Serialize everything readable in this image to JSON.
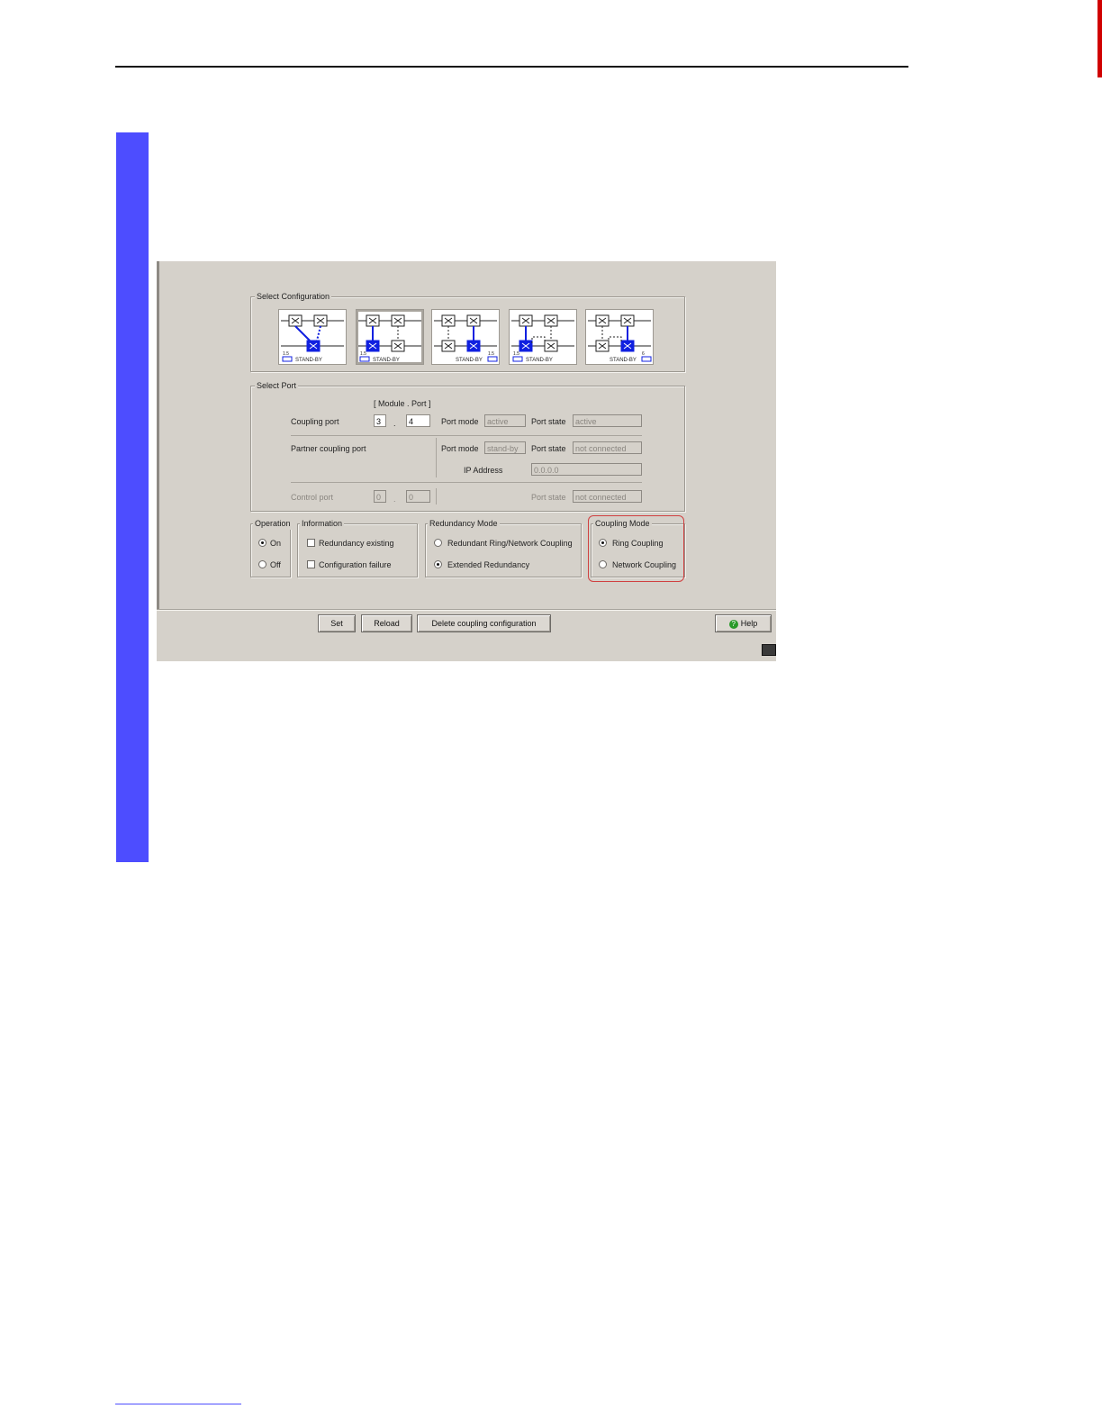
{
  "colors": {
    "sidebar": "#4d4dff",
    "tab": "#d00000",
    "highlight": "#d04040",
    "active_switch": "#1020e0"
  },
  "select_configuration": {
    "title": "Select Configuration",
    "options": [
      {
        "badge": "1.5",
        "caption": "STAND-BY",
        "selected": false
      },
      {
        "badge": "1.5",
        "caption": "STAND-BY",
        "selected": true
      },
      {
        "badge": "1.5",
        "caption": "STAND-BY",
        "selected": false
      },
      {
        "badge": "1.5",
        "caption": "STAND-BY",
        "selected": false
      },
      {
        "badge": "6",
        "caption": "STAND-BY",
        "selected": false
      }
    ]
  },
  "select_port": {
    "title": "Select Port",
    "module_port_header": "[ Module . Port ]",
    "coupling_port": {
      "label": "Coupling port",
      "module": "3",
      "port": "4",
      "sep": ".",
      "port_mode_label": "Port mode",
      "port_mode": "active",
      "port_state_label": "Port state",
      "port_state": "active"
    },
    "partner_port": {
      "label": "Partner coupling port",
      "port_mode_label": "Port mode",
      "port_mode": "stand-by",
      "port_state_label": "Port state",
      "port_state": "not connected",
      "ip_label": "IP Address",
      "ip": "0.0.0.0"
    },
    "control_port": {
      "label": "Control port",
      "module": "0",
      "port": "0",
      "sep": ".",
      "port_state_label": "Port state",
      "port_state": "not connected"
    }
  },
  "operation": {
    "title": "Operation",
    "on": "On",
    "off": "Off",
    "value": "On"
  },
  "information": {
    "title": "Information",
    "redundancy_existing": "Redundancy existing",
    "configuration_failure": "Configuration failure"
  },
  "redundancy_mode": {
    "title": "Redundancy Mode",
    "option1": "Redundant Ring/Network Coupling",
    "option2": "Extended Redundancy",
    "value": "Extended Redundancy"
  },
  "coupling_mode": {
    "title": "Coupling Mode",
    "option1": "Ring Coupling",
    "option2": "Network Coupling",
    "value": "Ring Coupling"
  },
  "buttons": {
    "set": "Set",
    "reload": "Reload",
    "delete": "Delete coupling configuration",
    "help": "Help"
  }
}
